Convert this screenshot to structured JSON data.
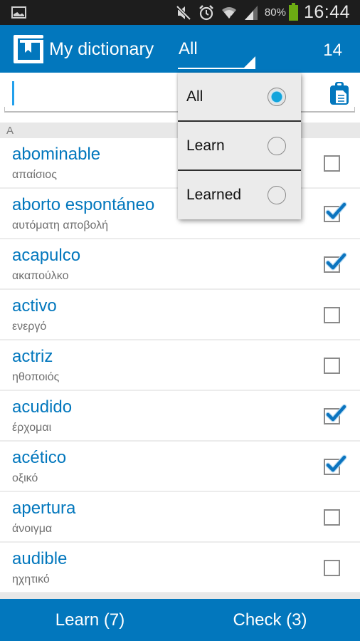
{
  "status_bar": {
    "left_icon": "image-notification-icon",
    "icons": [
      "mute-icon",
      "alarm-icon",
      "wifi-icon",
      "signal-icon"
    ],
    "battery_percent": "80%",
    "battery_icon": "battery-icon",
    "time": "16:44"
  },
  "app_bar": {
    "logo_icon": "dictionary-book-icon",
    "title": "My dictionary",
    "filter_value": "All",
    "count": "14"
  },
  "search": {
    "value": "",
    "placeholder": "",
    "paste_icon": "clipboard-icon"
  },
  "section_header": "A",
  "entries": [
    {
      "word": "abominable",
      "translation": "απαίσιος",
      "checked": false
    },
    {
      "word": "aborto espontáneo",
      "translation": "αυτόματη αποβολή",
      "checked": true
    },
    {
      "word": "acapulco",
      "translation": "ακαπούλκο",
      "checked": true
    },
    {
      "word": "activo",
      "translation": "ενεργό",
      "checked": false
    },
    {
      "word": "actriz",
      "translation": "ηθοποιός",
      "checked": false
    },
    {
      "word": "acudido",
      "translation": "έρχομαι",
      "checked": true
    },
    {
      "word": "acético",
      "translation": "οξικό",
      "checked": true
    },
    {
      "word": "apertura",
      "translation": "άνοιγμα",
      "checked": false
    },
    {
      "word": "audible",
      "translation": "ηχητικό",
      "checked": false
    }
  ],
  "filter_dropdown": {
    "options": [
      {
        "label": "All",
        "selected": true
      },
      {
        "label": "Learn",
        "selected": false
      },
      {
        "label": "Learned",
        "selected": false
      }
    ]
  },
  "bottom_bar": {
    "learn_label": "Learn (7)",
    "check_label": "Check (3)"
  },
  "colors": {
    "primary": "#0277bd",
    "status_bar": "#1d1d1d",
    "battery": "#6cab13",
    "radio_selected": "#12a4dc"
  }
}
